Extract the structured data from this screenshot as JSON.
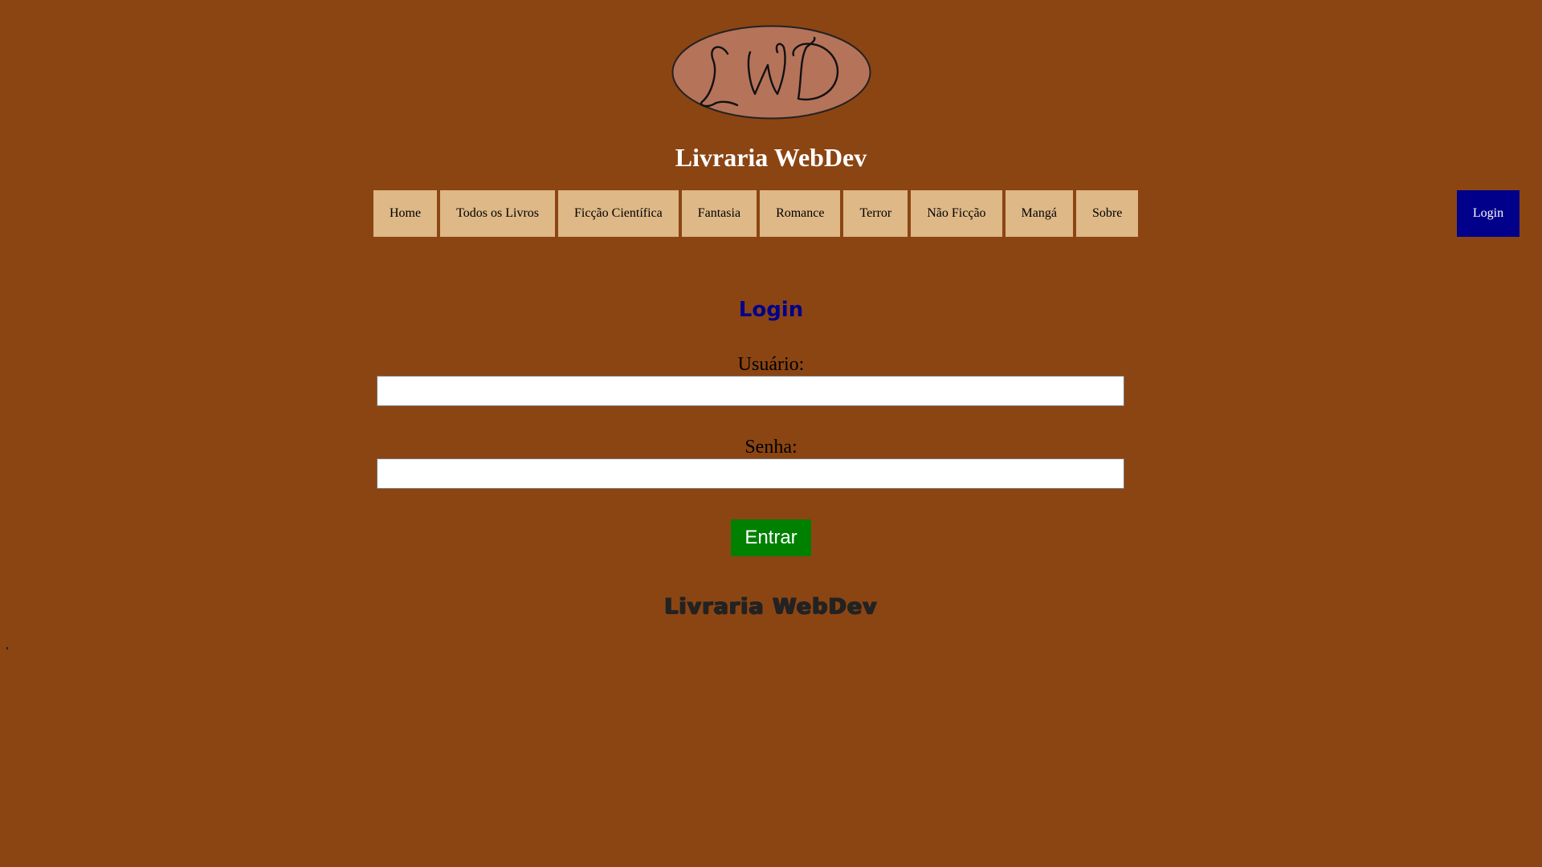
{
  "colors": {
    "background": "#8B4513",
    "nav_item_bg": "#DEB887",
    "login_link_bg": "#00008B",
    "heading": "#00008B",
    "submit_bg": "#008000",
    "logo_fill": "#B5735A"
  },
  "header": {
    "logo_icon": "lwd-logo-icon",
    "logo_text": "LWD",
    "site_title": "Livraria WebDev"
  },
  "nav": {
    "items": [
      {
        "label": "Home"
      },
      {
        "label": "Todos os Livros"
      },
      {
        "label": "Ficção Científica"
      },
      {
        "label": "Fantasia"
      },
      {
        "label": "Romance"
      },
      {
        "label": "Terror"
      },
      {
        "label": "Não Ficção"
      },
      {
        "label": "Mangá"
      },
      {
        "label": "Sobre"
      }
    ],
    "login_label": "Login"
  },
  "login_form": {
    "heading": "Login",
    "user_label": "Usuário:",
    "user_value": "",
    "password_label": "Senha:",
    "password_value": "",
    "submit_label": "Entrar"
  },
  "footer": {
    "title": "Livraria WebDev"
  }
}
